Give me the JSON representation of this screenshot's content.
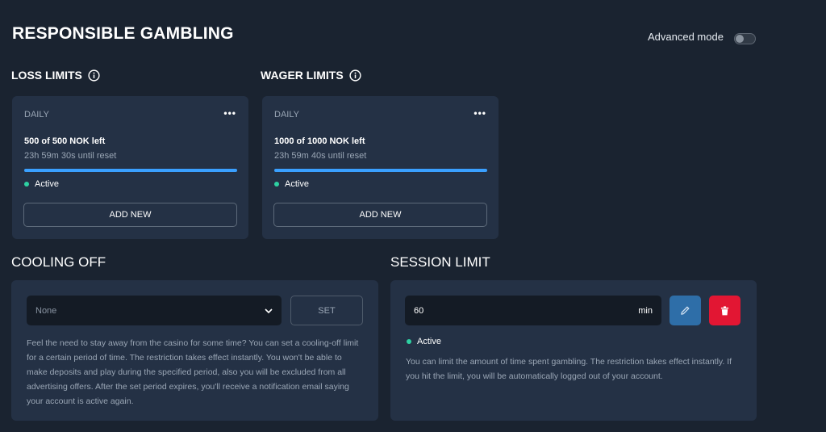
{
  "header": {
    "title": "RESPONSIBLE GAMBLING",
    "advanced_mode_label": "Advanced mode",
    "advanced_mode_on": false
  },
  "loss_limits": {
    "title": "LOSS LIMITS",
    "card": {
      "period": "DAILY",
      "amount_text": "500 of 500 NOK left",
      "reset_text": "23h 59m 30s until reset",
      "remaining_fraction": 1.0,
      "status": "Active",
      "add_new_label": "ADD NEW"
    }
  },
  "wager_limits": {
    "title": "WAGER LIMITS",
    "card": {
      "period": "DAILY",
      "amount_text": "1000 of 1000 NOK left",
      "reset_text": "23h 59m 40s until reset",
      "remaining_fraction": 1.0,
      "status": "Active",
      "add_new_label": "ADD NEW"
    }
  },
  "cooling_off": {
    "title": "COOLING OFF",
    "select_value": "None",
    "set_label": "SET",
    "description": "Feel the need to stay away from the casino for some time? You can set a cooling-off limit for a certain period of time. The restriction takes effect instantly. You won't be able to make deposits and play during the specified period, also you will be excluded from all advertising offers. After the set period expires, you'll receive a notification email saying your account is active again."
  },
  "session_limit": {
    "title": "SESSION LIMIT",
    "value": "60",
    "unit": "min",
    "status": "Active",
    "description": "You can limit the amount of time spent gambling. The restriction takes effect instantly. If you hit the limit, you will be automatically logged out of your account."
  },
  "colors": {
    "background": "#1a2330",
    "card": "#243145",
    "accent_blue": "#3aa0ff",
    "active_green": "#2ed1a2",
    "edit_blue": "#2e6ea8",
    "delete_red": "#e21633"
  },
  "icons": {
    "info": "info-icon",
    "more": "more-icon",
    "chevron": "chevron-down-icon",
    "edit": "pencil-icon",
    "delete": "trash-icon"
  }
}
